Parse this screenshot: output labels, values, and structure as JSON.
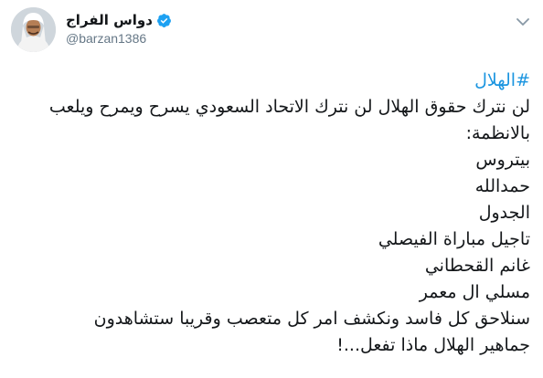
{
  "author": {
    "display_name": "دواس الفراج",
    "handle": "@barzan1386",
    "verified": true,
    "avatar_icon": "avatar-photo",
    "verified_icon": "verified-badge-icon",
    "verified_color": "#1da1f2"
  },
  "menu": {
    "caret_icon": "chevron-down-icon",
    "caret_color": "#8899a6"
  },
  "tweet": {
    "hashtag": "#الهلال",
    "hashtag_color": "#1b95e0",
    "line1": "لن نترك حقوق الهلال لن نترك الاتحاد السعودي يسرح ويمرح ويلعب",
    "line2": "بالانظمة:",
    "line3": "بيتروس",
    "line4": "حمدالله",
    "line5": "الجدول",
    "line6": "تاجيل مباراة الفيصلي",
    "line7": "غانم القحطاني",
    "line8": "مسلي ال معمر",
    "line9": "سنلاحق كل فاسد ونكشف امر كل متعصب وقريبا ستشاهدون",
    "line10": "جماهير الهلال ماذا تفعل...!"
  }
}
